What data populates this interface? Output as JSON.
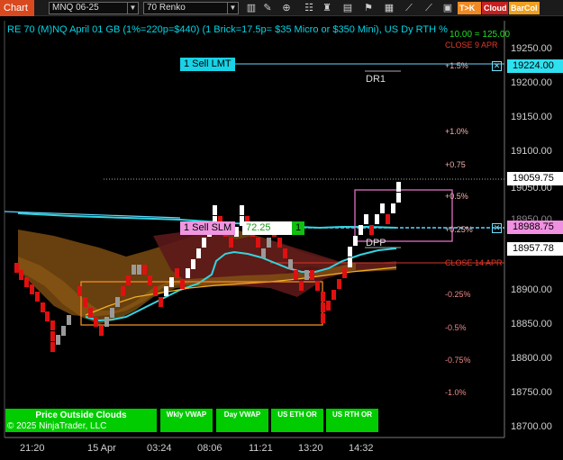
{
  "toolbar": {
    "tab_label": "Chart",
    "instrument": "MNQ 06-25",
    "bar_type": "70 Renko",
    "btn_tok": "T>K",
    "btn_cloud": "Cloud",
    "btn_barcol": "BarCol",
    "colors": {
      "tok_bg": "#f08a24",
      "cloud_bg": "#c62020",
      "barcol_bg": "#f0a020"
    }
  },
  "chart": {
    "title": "RE 70 (M)NQ April 01 GB (1%=220p=$440) (1 Brick=17.5p= $35 Micro or $350 Mini), US Dy RTH %",
    "pnl_label": "10.00 = 125.00",
    "close_top": "CLOSE 9 APR",
    "close_mid": "CLOSE 14 APR",
    "dr1": "DR1",
    "dpp": "DPP",
    "copyright": "© 2025 NinjaTrader, LLC"
  },
  "price_axis": [
    "19250.00",
    "19200.00",
    "19150.00",
    "19100.00",
    "19050.00",
    "18950.00",
    "18900.00",
    "18850.00",
    "18800.00",
    "18750.00",
    "18700.00"
  ],
  "axis_flags": {
    "sell_lmt_price": "19224.00",
    "last_price": "19059.75",
    "sell_slm_price": "18988.75",
    "level_price": "18957.78"
  },
  "pct_levels": [
    "+1.5%",
    "+1.0%",
    "+0.75",
    "+0.5%",
    "+0.25%",
    "-0.25%",
    "-0.5%",
    "-0.75%",
    "-1.0%"
  ],
  "time_axis": [
    "21:20",
    "15 Apr",
    "03:24",
    "08:06",
    "11:21",
    "13:20",
    "14:32"
  ],
  "orders": {
    "sell_lmt": "1 Sell LMT",
    "sell_slm": "1 Sell SLM",
    "slm_pnl": "72.25",
    "slm_qty": "1",
    "close_glyph": "✕"
  },
  "indicator_buttons": {
    "price_outside_clouds": "Price Outside Clouds",
    "wkly_vwap": "Wkly VWAP",
    "day_vwap": "Day VWAP",
    "us_eth_or": "US ETH OR",
    "us_rth_or": "US RTH OR"
  }
}
